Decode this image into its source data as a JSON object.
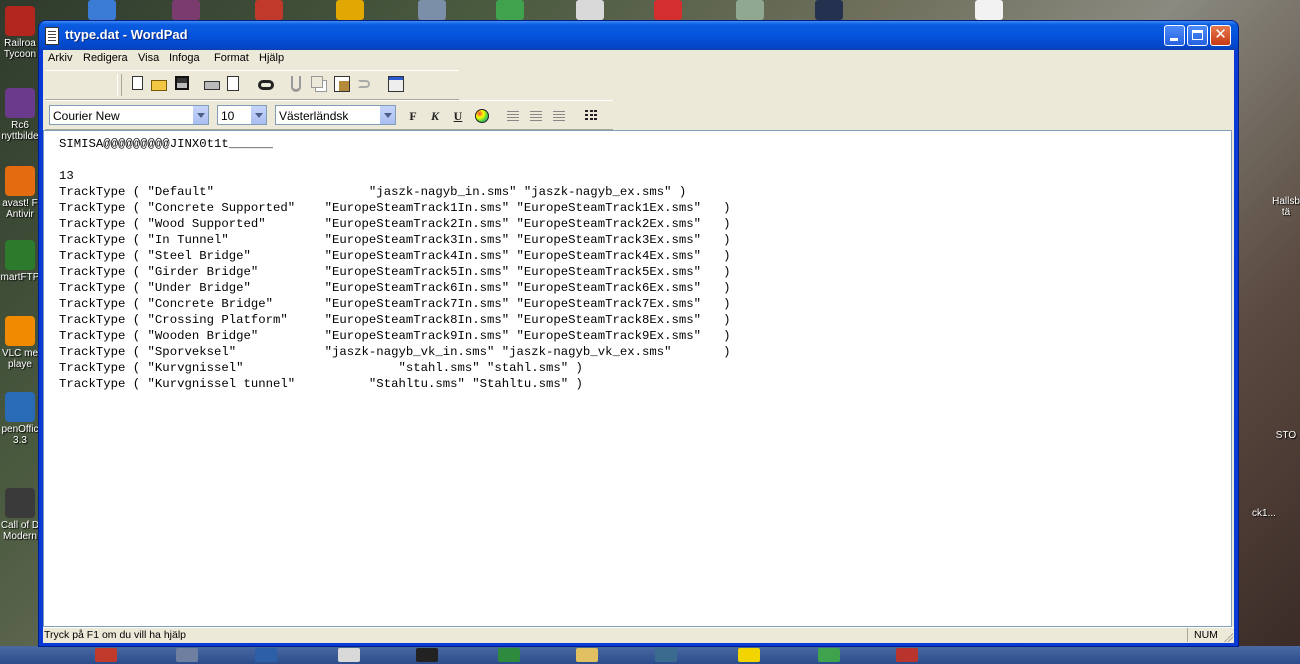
{
  "desktop": {
    "icons": [
      {
        "label": "Railroa\nTycoon",
        "color": "#b3261e"
      },
      {
        "label": "Rc6\nnyttbilde",
        "color": "#6a3b8c"
      },
      {
        "label": "avast! F\nAntivir",
        "color": "#e46b10"
      },
      {
        "label": "martFTP",
        "color": "#2c7a2c"
      },
      {
        "label": "VLC me\nplaye",
        "color": "#f08a00"
      },
      {
        "label": "penOffic\n3.3",
        "color": "#2a6bb8"
      },
      {
        "label": "Call of D\nModern",
        "color": "#3a3a3a"
      }
    ],
    "right_labels": [
      "Hallsb\ntä",
      "STO",
      "ck1..."
    ]
  },
  "window": {
    "title": "ttype.dat - WordPad",
    "colors": {
      "title_blue": "#0553dd",
      "close_red": "#c63a14",
      "chrome": "#ece9d8"
    }
  },
  "menu": [
    "Arkiv",
    "Redigera",
    "Visa",
    "Infoga",
    "Format",
    "Hjälp"
  ],
  "toolbar_icons": [
    "new-document-icon",
    "open-folder-icon",
    "save-icon",
    "print-icon",
    "print-preview-icon",
    "find-icon",
    "cut-icon",
    "copy-icon",
    "paste-icon",
    "undo-icon",
    "insert-datetime-icon"
  ],
  "format": {
    "font": "Courier New",
    "size": "10",
    "script": "Västerländsk",
    "bold_label": "F",
    "italic_label": "K",
    "underline_label": "U"
  },
  "document": {
    "lines": [
      "SIMISA@@@@@@@@@JINX0t1t______",
      "",
      "13",
      "TrackType ( \"Default\"                     \"jaszk-nagyb_in.sms\" \"jaszk-nagyb_ex.sms\" )",
      "TrackType ( \"Concrete Supported\"    \"EuropeSteamTrack1In.sms\" \"EuropeSteamTrack1Ex.sms\"   )",
      "TrackType ( \"Wood Supported\"        \"EuropeSteamTrack2In.sms\" \"EuropeSteamTrack2Ex.sms\"   )",
      "TrackType ( \"In Tunnel\"             \"EuropeSteamTrack3In.sms\" \"EuropeSteamTrack3Ex.sms\"   )",
      "TrackType ( \"Steel Bridge\"          \"EuropeSteamTrack4In.sms\" \"EuropeSteamTrack4Ex.sms\"   )",
      "TrackType ( \"Girder Bridge\"         \"EuropeSteamTrack5In.sms\" \"EuropeSteamTrack5Ex.sms\"   )",
      "TrackType ( \"Under Bridge\"          \"EuropeSteamTrack6In.sms\" \"EuropeSteamTrack6Ex.sms\"   )",
      "TrackType ( \"Concrete Bridge\"       \"EuropeSteamTrack7In.sms\" \"EuropeSteamTrack7Ex.sms\"   )",
      "TrackType ( \"Crossing Platform\"     \"EuropeSteamTrack8In.sms\" \"EuropeSteamTrack8Ex.sms\"   )",
      "TrackType ( \"Wooden Bridge\"         \"EuropeSteamTrack9In.sms\" \"EuropeSteamTrack9Ex.sms\"   )",
      "TrackType ( \"Sporveksel\"            \"jaszk-nagyb_vk_in.sms\" \"jaszk-nagyb_vk_ex.sms\"       )",
      "TrackType ( \"Kurvgnissel\"                     \"stahl.sms\" \"stahl.sms\" )",
      "TrackType ( \"Kurvgnissel tunnel\"          \"Stahltu.sms\" \"Stahltu.sms\" )"
    ]
  },
  "status": {
    "help_text": "Tryck på F1 om du vill ha hjälp",
    "num": "NUM"
  }
}
